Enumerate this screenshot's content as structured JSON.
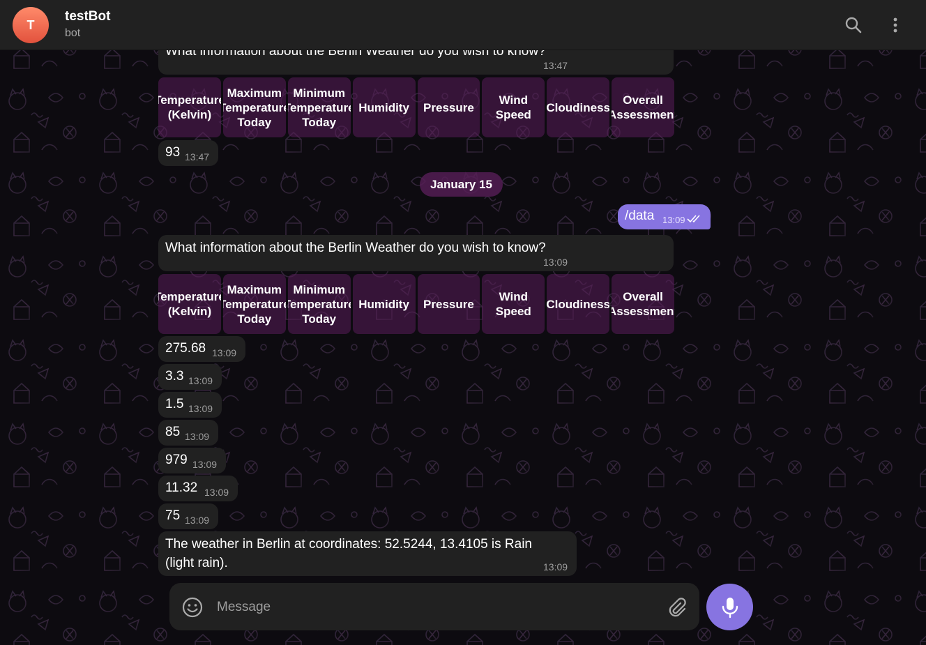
{
  "header": {
    "avatar_letter": "T",
    "title": "testBot",
    "status": "bot"
  },
  "messages": {
    "prompt1": {
      "text": "What information about the Berlin Weather do you wish to know?",
      "time": "13:47"
    },
    "keyboard1": [
      "Temperature\n(Kelvin)",
      "Maximum\nTemperature\nToday",
      "Minimum\nTemperature\nToday",
      "Humidity",
      "Pressure",
      "Wind\nSpeed",
      "Cloudiness",
      "Overall\nAssessment"
    ],
    "reply1": {
      "text": "93",
      "time": "13:47"
    },
    "date_separator": "January 15",
    "outgoing": {
      "text": "/data",
      "time": "13:09"
    },
    "prompt2": {
      "text": "What information about the Berlin Weather do you wish to know?",
      "time": "13:09"
    },
    "keyboard2": [
      "Temperature\n(Kelvin)",
      "Maximum\nTemperature\nToday",
      "Minimum\nTemperature\nToday",
      "Humidity",
      "Pressure",
      "Wind\nSpeed",
      "Cloudiness",
      "Overall\nAssessment"
    ],
    "values": [
      {
        "text": "275.68",
        "time": "13:09"
      },
      {
        "text": "3.3",
        "time": "13:09"
      },
      {
        "text": "1.5",
        "time": "13:09"
      },
      {
        "text": "85",
        "time": "13:09"
      },
      {
        "text": "979",
        "time": "13:09"
      },
      {
        "text": "11.32",
        "time": "13:09"
      },
      {
        "text": "75",
        "time": "13:09"
      }
    ],
    "summary": {
      "text": "The weather in Berlin at coordinates: 52.5244, 13.4105 is Rain (light rain).",
      "time": "13:09"
    }
  },
  "composer": {
    "placeholder": "Message",
    "icons": {
      "emoji": "smile-icon",
      "attach": "paperclip-icon",
      "send": "microphone-icon"
    }
  },
  "colors": {
    "accent": "#8774e1",
    "bubble": "#212121",
    "keyboard_button": "#5a1e5a",
    "header": "#212121"
  }
}
